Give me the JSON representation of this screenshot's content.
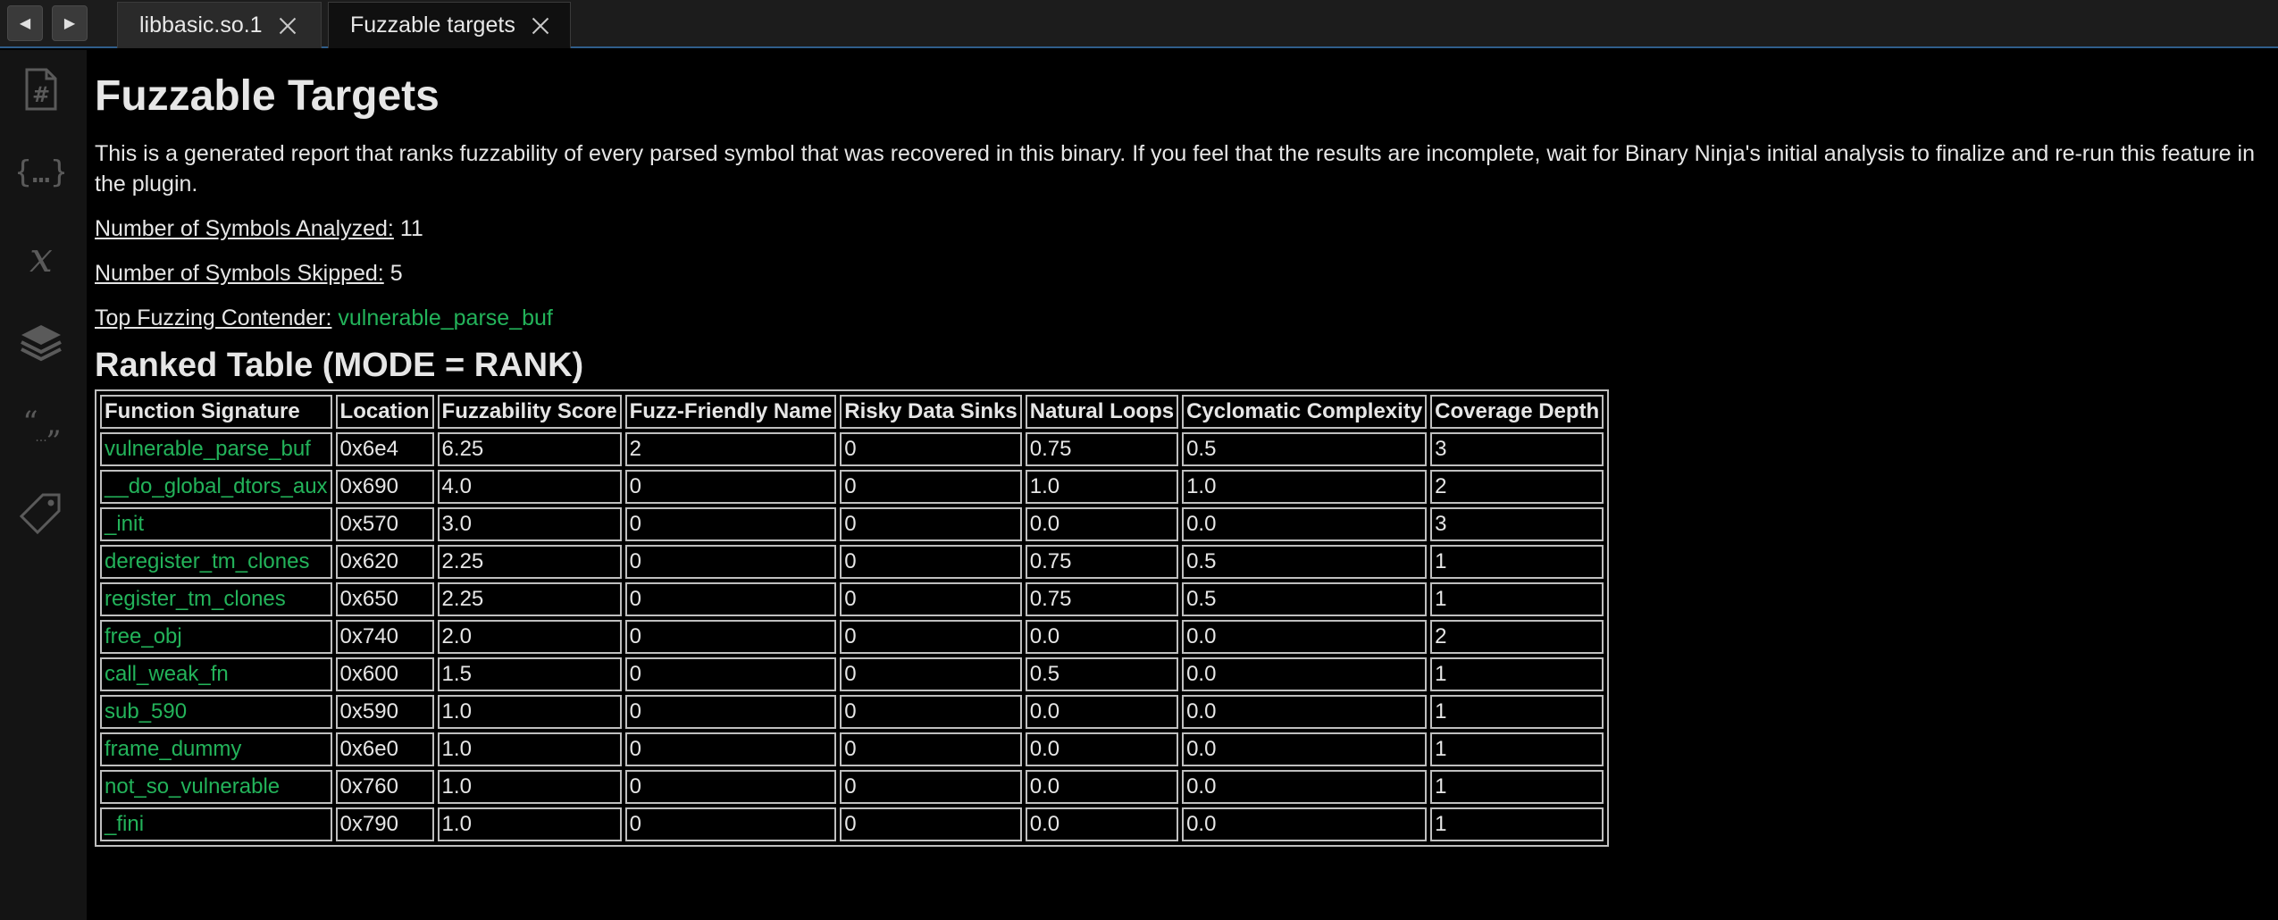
{
  "tabs": [
    {
      "label": "libbasic.so.1",
      "active": false
    },
    {
      "label": "Fuzzable targets",
      "active": true
    }
  ],
  "sidebar_icons": [
    "hash-icon",
    "braces-icon",
    "variable-icon",
    "layers-icon",
    "quote-icon",
    "tag-icon"
  ],
  "report": {
    "title": "Fuzzable Targets",
    "description": "This is a generated report that ranks fuzzability of every parsed symbol that was recovered in this binary. If you feel that the results are incomplete, wait for Binary Ninja's initial analysis to finalize and re-run this feature in the plugin.",
    "analyzed_label": "Number of Symbols Analyzed:",
    "analyzed_value": "11",
    "skipped_label": "Number of Symbols Skipped:",
    "skipped_value": "5",
    "top_label": "Top Fuzzing Contender:",
    "top_value": "vulnerable_parse_buf",
    "table_title": "Ranked Table (MODE = RANK)"
  },
  "table": {
    "headers": [
      "Function Signature",
      "Location",
      "Fuzzability Score",
      "Fuzz-Friendly Name",
      "Risky Data Sinks",
      "Natural Loops",
      "Cyclomatic Complexity",
      "Coverage Depth"
    ],
    "rows": [
      [
        "vulnerable_parse_buf",
        "0x6e4",
        "6.25",
        "2",
        "0",
        "0.75",
        "0.5",
        "3"
      ],
      [
        "__do_global_dtors_aux",
        "0x690",
        "4.0",
        "0",
        "0",
        "1.0",
        "1.0",
        "2"
      ],
      [
        "_init",
        "0x570",
        "3.0",
        "0",
        "0",
        "0.0",
        "0.0",
        "3"
      ],
      [
        "deregister_tm_clones",
        "0x620",
        "2.25",
        "0",
        "0",
        "0.75",
        "0.5",
        "1"
      ],
      [
        "register_tm_clones",
        "0x650",
        "2.25",
        "0",
        "0",
        "0.75",
        "0.5",
        "1"
      ],
      [
        "free_obj",
        "0x740",
        "2.0",
        "0",
        "0",
        "0.0",
        "0.0",
        "2"
      ],
      [
        "call_weak_fn",
        "0x600",
        "1.5",
        "0",
        "0",
        "0.5",
        "0.0",
        "1"
      ],
      [
        "sub_590",
        "0x590",
        "1.0",
        "0",
        "0",
        "0.0",
        "0.0",
        "1"
      ],
      [
        "frame_dummy",
        "0x6e0",
        "1.0",
        "0",
        "0",
        "0.0",
        "0.0",
        "1"
      ],
      [
        "not_so_vulnerable",
        "0x760",
        "1.0",
        "0",
        "0",
        "0.0",
        "0.0",
        "1"
      ],
      [
        "_fini",
        "0x790",
        "1.0",
        "0",
        "0",
        "0.0",
        "0.0",
        "1"
      ]
    ]
  },
  "colors": {
    "accent_green": "#23b35a",
    "background": "#000000",
    "tab_underline": "#2f5d8a"
  }
}
